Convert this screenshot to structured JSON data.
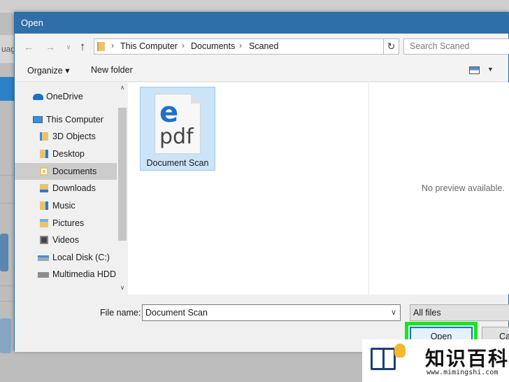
{
  "background": {
    "side_text": "uag"
  },
  "dialog": {
    "title": "Open",
    "address": {
      "back_icon": "arrow-left-icon",
      "forward_icon": "arrow-right-icon",
      "up_icon": "arrow-up-icon",
      "breadcrumbs": [
        "This Computer",
        "Documents",
        "Scaned"
      ],
      "search_placeholder": "Search Scaned"
    },
    "toolbar": {
      "organize_label": "Organize ▾",
      "new_folder_label": "New folder"
    },
    "nav": [
      {
        "label": "OneDrive",
        "icon": "cloud-icon"
      },
      {
        "label": "This Computer",
        "icon": "computer-icon"
      },
      {
        "label": "3D Objects",
        "icon": "cube-folder-icon"
      },
      {
        "label": "Desktop",
        "icon": "desktop-folder-icon"
      },
      {
        "label": "Documents",
        "icon": "documents-folder-icon",
        "selected": true
      },
      {
        "label": "Downloads",
        "icon": "downloads-folder-icon"
      },
      {
        "label": "Music",
        "icon": "music-folder-icon"
      },
      {
        "label": "Pictures",
        "icon": "pictures-folder-icon"
      },
      {
        "label": "Videos",
        "icon": "videos-folder-icon"
      },
      {
        "label": "Local Disk (C:)",
        "icon": "drive-icon"
      },
      {
        "label": "Multimedia HDD",
        "icon": "drive-icon"
      }
    ],
    "files": [
      {
        "name": "Document Scan",
        "icon": "edge-pdf-icon",
        "icon_text": "pdf"
      }
    ],
    "preview_text": "No preview available.",
    "bottom": {
      "file_name_label": "File name:",
      "file_name_value": "Document Scan",
      "file_type": "All files",
      "open_label": "Open",
      "cancel_label": "Cancel"
    }
  },
  "watermark": {
    "title": "知识百科",
    "url": "www.mimingshi.com"
  },
  "colors": {
    "titlebar": "#2f6fa9",
    "highlight": "#14e81a",
    "selection": "#cce4f7"
  }
}
